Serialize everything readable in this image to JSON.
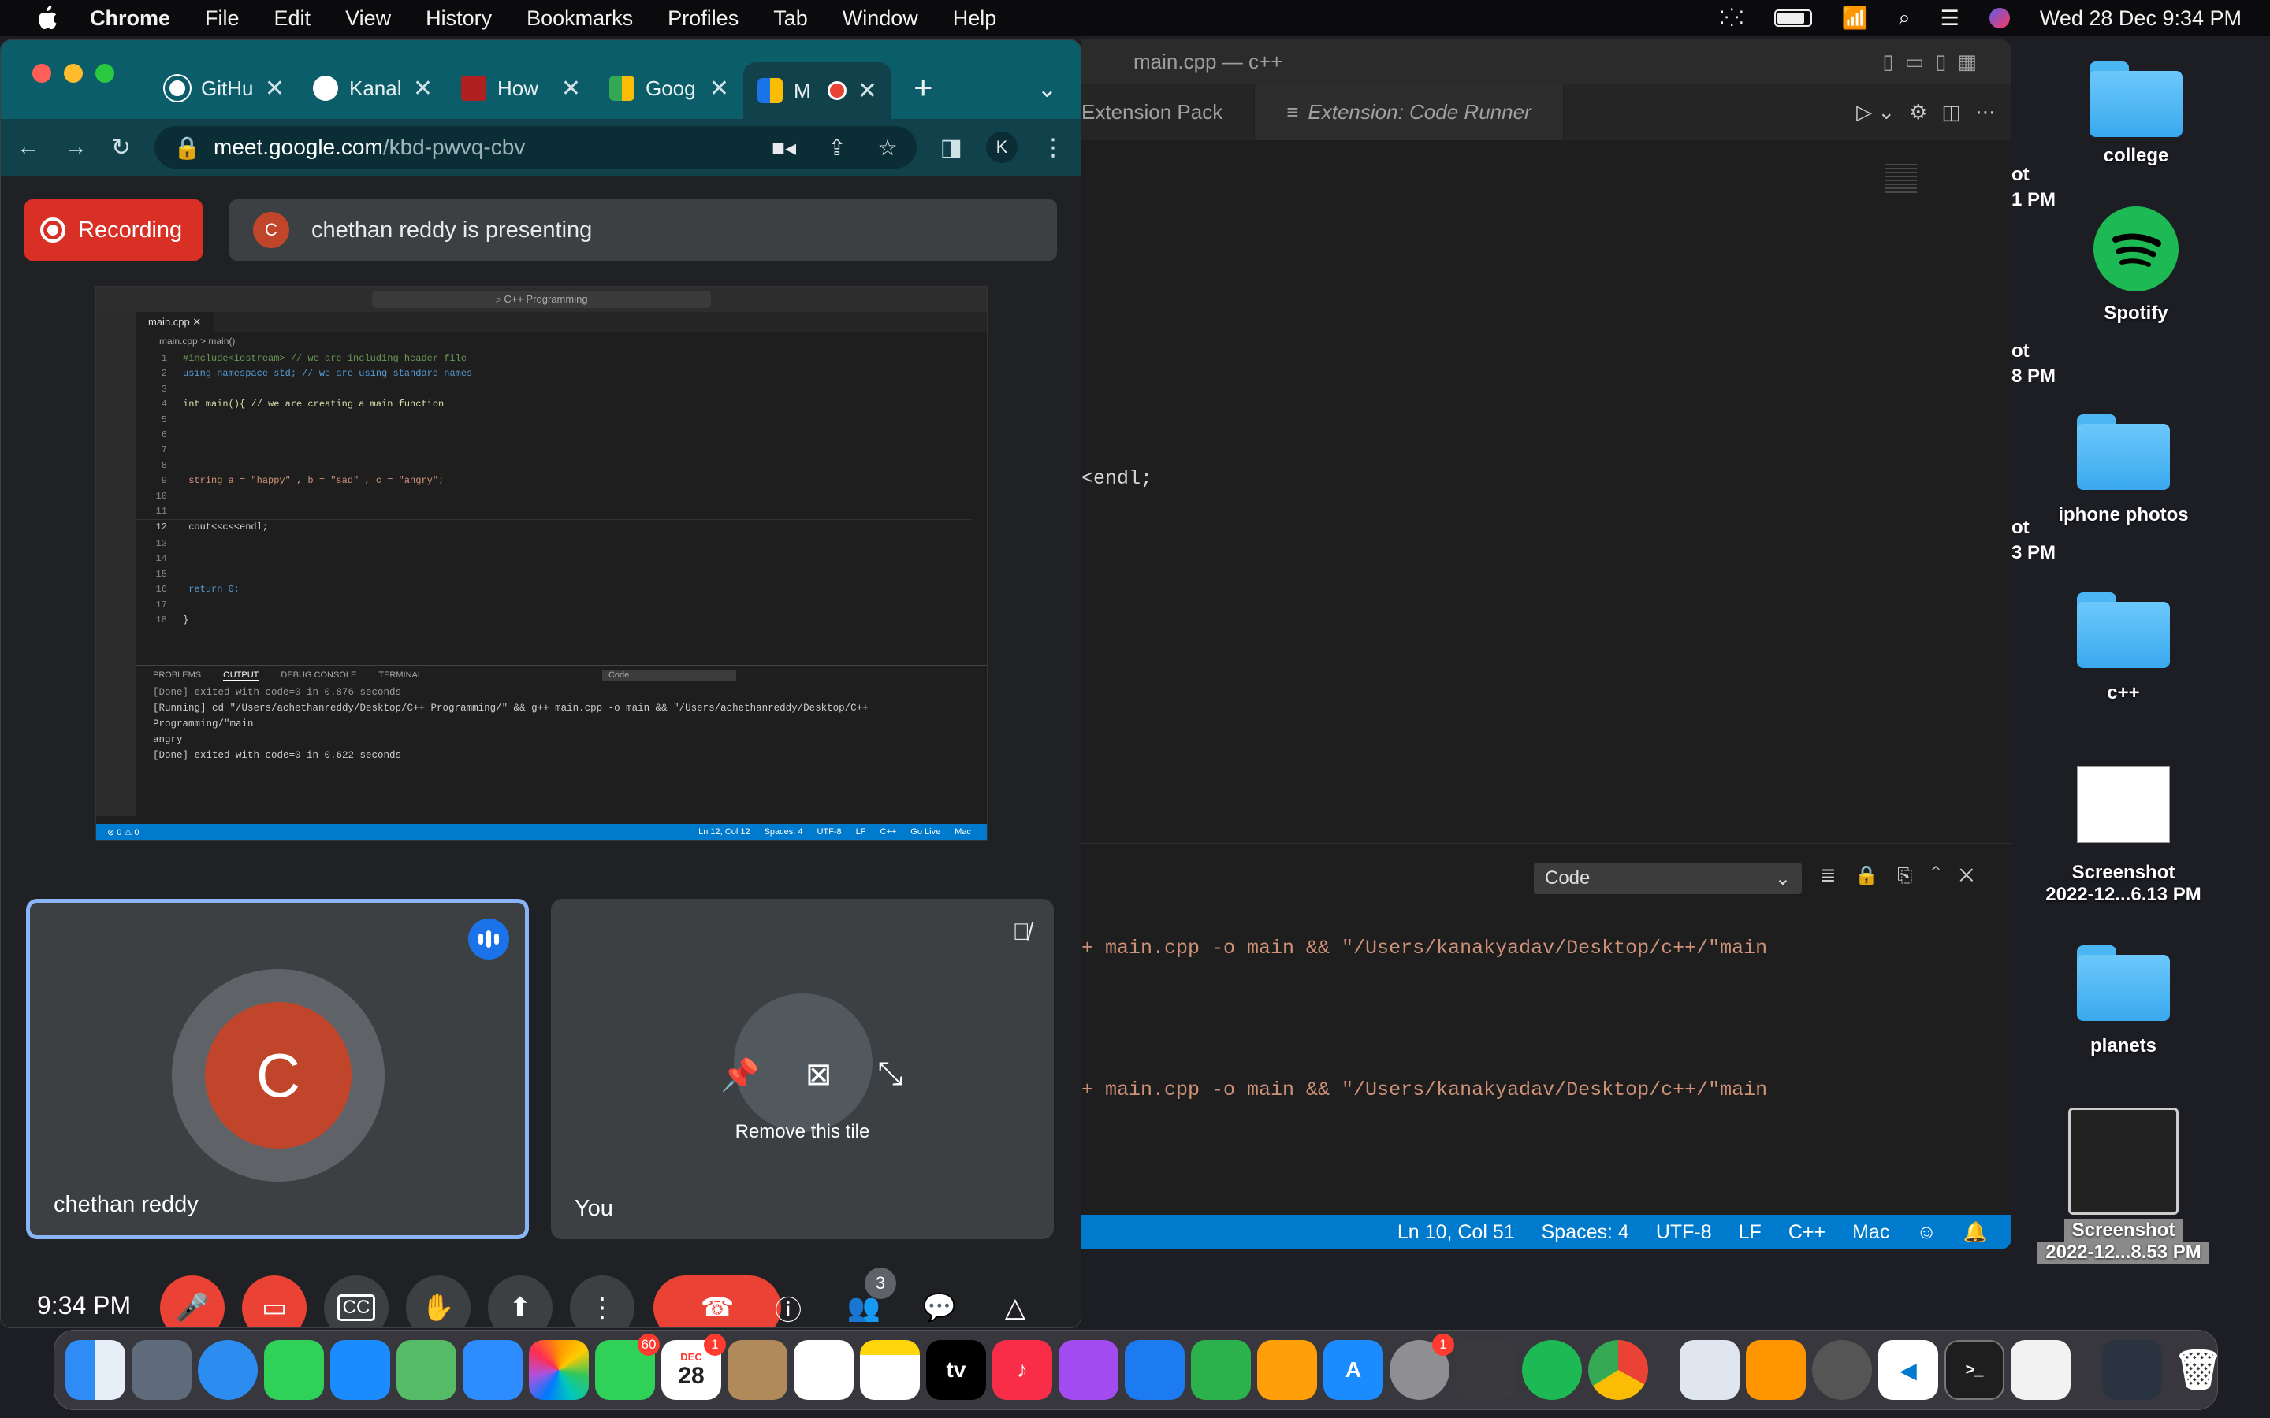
{
  "menubar": {
    "app": "Chrome",
    "items": [
      "File",
      "Edit",
      "View",
      "History",
      "Bookmarks",
      "Profiles",
      "Tab",
      "Window",
      "Help"
    ],
    "clock": "Wed 28 Dec  9:34 PM"
  },
  "chrome": {
    "tabs": [
      {
        "title": "GitHu",
        "color": "#ffffff"
      },
      {
        "title": "Kanal",
        "color": "#ffffff"
      },
      {
        "title": "How",
        "color": "#b02020"
      },
      {
        "title": "Goog",
        "color": "#34a853"
      },
      {
        "title": "M",
        "color": "#1a73e8"
      }
    ],
    "new_tab": "+",
    "url_host": "meet.google.com",
    "url_path": "/kbd-pwvq-cbv",
    "profile": "K"
  },
  "meet": {
    "recording_label": "Recording",
    "presenter_initial": "C",
    "presenting_text": "chethan reddy is presenting",
    "tile_left_name": "chethan reddy",
    "tile_left_initial": "C",
    "tile_right_name": "You",
    "tile_right_action": "Remove this tile",
    "time": "9:34 PM",
    "participants_count": "3"
  },
  "shared_screen": {
    "search": "C++ Programming",
    "tab": "main.cpp",
    "breadcrumb": "main.cpp > main()",
    "code": [
      {
        "n": "1",
        "text": "#include<iostream> // we are including header file"
      },
      {
        "n": "2",
        "text": "using namespace std; // we are using standard names"
      },
      {
        "n": "3",
        "text": ""
      },
      {
        "n": "4",
        "text": "int main(){ // we are creating a main function"
      },
      {
        "n": "5",
        "text": ""
      },
      {
        "n": "6",
        "text": ""
      },
      {
        "n": "7",
        "text": ""
      },
      {
        "n": "8",
        "text": ""
      },
      {
        "n": "9",
        "text": "    string a = \"happy\" , b = \"sad\" , c = \"angry\";"
      },
      {
        "n": "10",
        "text": ""
      },
      {
        "n": "11",
        "text": ""
      },
      {
        "n": "12",
        "text": "    cout<<c<<endl;"
      },
      {
        "n": "13",
        "text": ""
      },
      {
        "n": "14",
        "text": ""
      },
      {
        "n": "15",
        "text": ""
      },
      {
        "n": "16",
        "text": "    return 0;"
      },
      {
        "n": "17",
        "text": ""
      },
      {
        "n": "18",
        "text": "}"
      }
    ],
    "panel_tabs": [
      "PROBLEMS",
      "OUTPUT",
      "DEBUG CONSOLE",
      "TERMINAL"
    ],
    "panel_select": "Code",
    "output": [
      "[Done] exited with code=0 in 0.876 seconds",
      "",
      "[Running] cd \"/Users/achethanreddy/Desktop/C++ Programming/\" && g++ main.cpp -o main && \"/Users/achethanreddy/Desktop/C++",
      "Programming/\"main",
      "angry",
      "",
      "[Done] exited with code=0 in 0.622 seconds"
    ],
    "status": [
      "Ln 12, Col 12",
      "Spaces: 4",
      "UTF-8",
      "LF",
      "C++",
      "Go Live",
      "Mac"
    ],
    "status_left": "⊗ 0 ⚠ 0"
  },
  "vscode": {
    "title": "main.cpp — c++",
    "tab1": "Extension Pack",
    "tab2": "Extension: Code Runner",
    "editor_line": "<endl;",
    "panel_select": "Code",
    "out1": "+ main.cpp -o main && \"/Users/kanakyadav/Desktop/c++/\"main",
    "out2": "+ main.cpp -o main && \"/Users/kanakyadav/Desktop/c++/\"main",
    "status": [
      "Ln 10, Col 51",
      "Spaces: 4",
      "UTF-8",
      "LF",
      "C++",
      "Mac"
    ]
  },
  "desktop": {
    "items": [
      "college",
      "Spotify",
      "iphone photos",
      "c++",
      "Screenshot",
      "2022-12...6.13 PM",
      "planets",
      "Screenshot",
      "2022-12...8.53 PM"
    ],
    "partial_labels": [
      "ot",
      "1 PM",
      "ot",
      "8 PM",
      "ot",
      "3 PM"
    ]
  },
  "dock": {
    "facetime_badge": "60",
    "calendar_month": "DEC",
    "calendar_day": "28",
    "calendar_badge": "1",
    "settings_badge": "1",
    "tv_label": "tv"
  }
}
